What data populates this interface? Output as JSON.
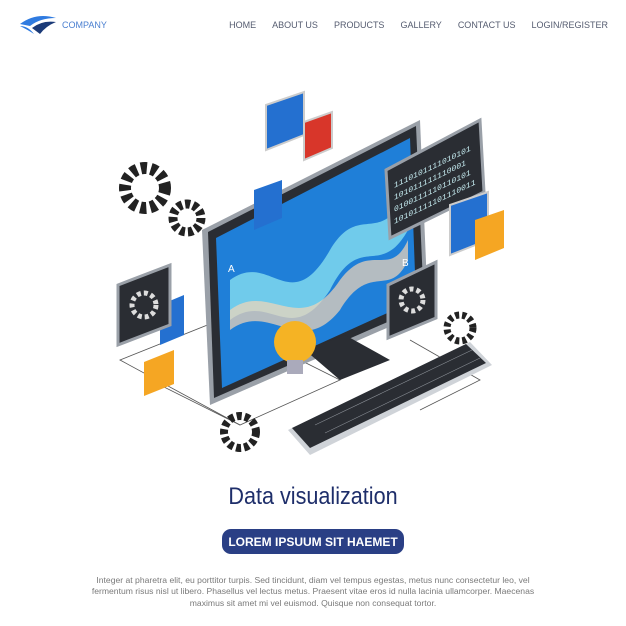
{
  "header": {
    "logo_text": "COMPANY",
    "nav": [
      "HOME",
      "ABOUT US",
      "PRODUCTS",
      "GALLERY",
      "CONTACT US",
      "LOGIN/REGISTER"
    ]
  },
  "illustration": {
    "label_a": "A",
    "label_b": "B",
    "binary": [
      "1110101111010101",
      "101011111110001",
      "0100111110110101",
      "10101111101110011"
    ]
  },
  "hero": {
    "title": "Data visualization",
    "button": "LOREM IPSUUM SIT HAEMET",
    "description": "Integer at pharetra elit, eu porttitor turpis. Sed tincidunt, diam vel tempus egestas, metus nunc consectetur leo, vel fermentum risus nisl ut libero. Phasellus vel lectus metus. Praesent vitae eros id nulla lacinia ullamcorper. Maecenas maximus sit amet mi vel euismod. Quisque non consequat tortor."
  },
  "colors": {
    "accent": "#2a3f85",
    "title": "#1e2e6a",
    "logo": "#4a7fd0",
    "screen": "#1f7fd8",
    "bulb": "#f5b324",
    "red": "#d8362a"
  }
}
